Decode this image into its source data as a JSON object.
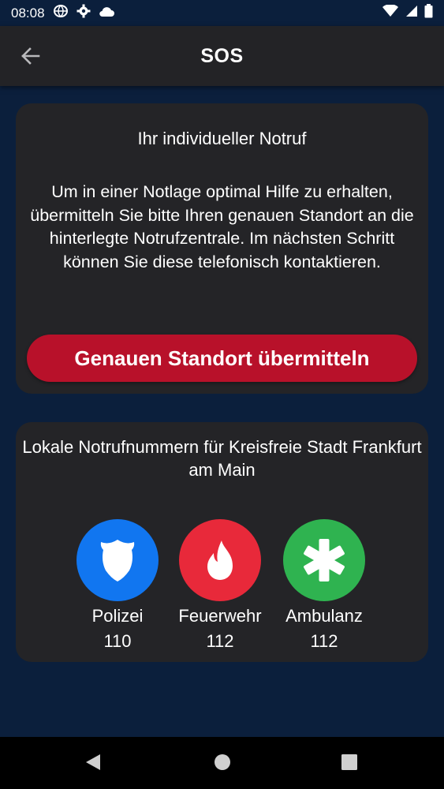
{
  "status_bar": {
    "time": "08:08"
  },
  "header": {
    "title": "SOS",
    "back_icon": "arrow-left-icon"
  },
  "location_card": {
    "heading": "Ihr individueller Notruf",
    "body": "Um in einer Notlage optimal Hilfe zu erhalten, übermitteln Sie bitte Ihren genauen Standort an die hinterlegte Notrufzentrale. Im nächsten Schritt können Sie diese telefonisch kontaktieren.",
    "button_label": "Genauen Standort übermitteln",
    "button_color": "#b8112a"
  },
  "numbers_card": {
    "heading": "Lokale Notrufnummern für Kreisfreie Stadt Frankfurt am Main",
    "services": [
      {
        "label": "Polizei",
        "number": "110",
        "color": "#1176f0",
        "icon": "police-shield-icon"
      },
      {
        "label": "Feuerwehr",
        "number": "112",
        "color": "#e8293a",
        "icon": "fire-flame-icon"
      },
      {
        "label": "Ambulanz",
        "number": "112",
        "color": "#2fb350",
        "icon": "medical-star-icon"
      }
    ]
  },
  "colors": {
    "background": "#0b1f3c",
    "card": "#242427",
    "app_bar": "#232326"
  }
}
